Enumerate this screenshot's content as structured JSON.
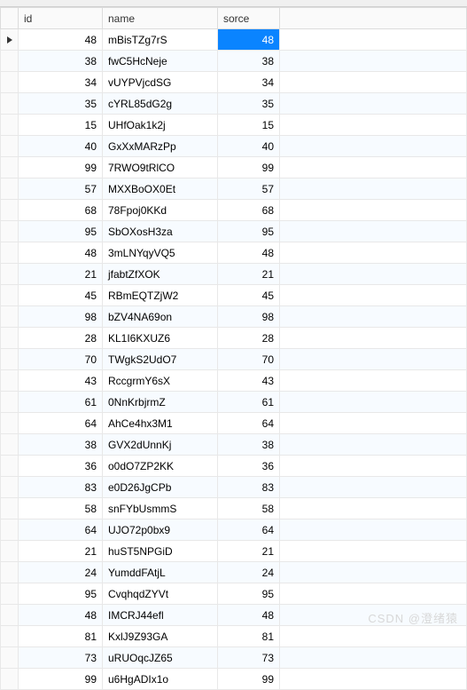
{
  "columns": {
    "id": "id",
    "name": "name",
    "sorce": "sorce"
  },
  "rows": [
    {
      "id": "48",
      "name": "mBisTZg7rS",
      "sorce": "48",
      "current": true
    },
    {
      "id": "38",
      "name": "fwC5HcNeje",
      "sorce": "38"
    },
    {
      "id": "34",
      "name": "vUYPVjcdSG",
      "sorce": "34"
    },
    {
      "id": "35",
      "name": "cYRL85dG2g",
      "sorce": "35"
    },
    {
      "id": "15",
      "name": "UHfOak1k2j",
      "sorce": "15"
    },
    {
      "id": "40",
      "name": "GxXxMARzPp",
      "sorce": "40"
    },
    {
      "id": "99",
      "name": "7RWO9tRlCO",
      "sorce": "99"
    },
    {
      "id": "57",
      "name": "MXXBoOX0Et",
      "sorce": "57"
    },
    {
      "id": "68",
      "name": "78Fpoj0KKd",
      "sorce": "68"
    },
    {
      "id": "95",
      "name": "SbOXosH3za",
      "sorce": "95"
    },
    {
      "id": "48",
      "name": "3mLNYqyVQ5",
      "sorce": "48"
    },
    {
      "id": "21",
      "name": "jfabtZfXOK",
      "sorce": "21"
    },
    {
      "id": "45",
      "name": "RBmEQTZjW2",
      "sorce": "45"
    },
    {
      "id": "98",
      "name": "bZV4NA69on",
      "sorce": "98"
    },
    {
      "id": "28",
      "name": "KL1I6KXUZ6",
      "sorce": "28"
    },
    {
      "id": "70",
      "name": "TWgkS2UdO7",
      "sorce": "70"
    },
    {
      "id": "43",
      "name": "RccgrmY6sX",
      "sorce": "43"
    },
    {
      "id": "61",
      "name": "0NnKrbjrmZ",
      "sorce": "61"
    },
    {
      "id": "64",
      "name": "AhCe4hx3M1",
      "sorce": "64"
    },
    {
      "id": "38",
      "name": "GVX2dUnnKj",
      "sorce": "38"
    },
    {
      "id": "36",
      "name": "o0dO7ZP2KK",
      "sorce": "36"
    },
    {
      "id": "83",
      "name": "e0D26JgCPb",
      "sorce": "83"
    },
    {
      "id": "58",
      "name": "snFYbUsmmS",
      "sorce": "58"
    },
    {
      "id": "64",
      "name": "UJO72p0bx9",
      "sorce": "64"
    },
    {
      "id": "21",
      "name": "huST5NPGiD",
      "sorce": "21"
    },
    {
      "id": "24",
      "name": "YumddFAtjL",
      "sorce": "24"
    },
    {
      "id": "95",
      "name": "CvqhqdZYVt",
      "sorce": "95"
    },
    {
      "id": "48",
      "name": "IMCRJ44efl",
      "sorce": "48"
    },
    {
      "id": "81",
      "name": "KxlJ9Z93GA",
      "sorce": "81"
    },
    {
      "id": "73",
      "name": "uRUOqcJZ65",
      "sorce": "73"
    },
    {
      "id": "99",
      "name": "u6HgADIx1o",
      "sorce": "99"
    }
  ],
  "selected_cell": {
    "row_index": 0,
    "col": "sorce"
  },
  "watermark": "CSDN @澄绪猿"
}
